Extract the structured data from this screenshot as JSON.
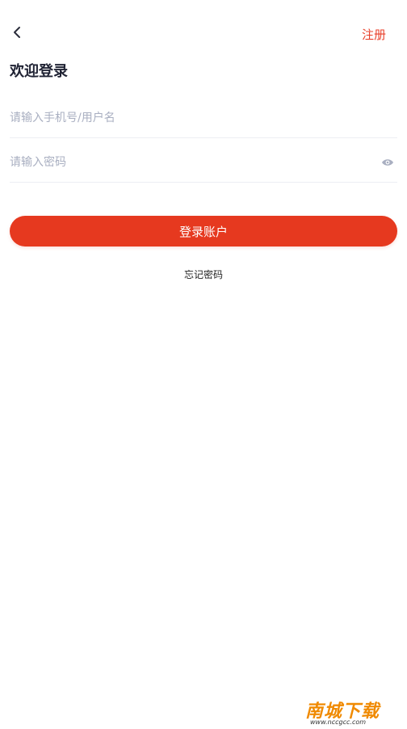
{
  "header": {
    "back_icon": "chevron-left-icon",
    "register_label": "注册"
  },
  "page": {
    "title": "欢迎登录"
  },
  "form": {
    "username_placeholder": "请输入手机号/用户名",
    "password_placeholder": "请输入密码",
    "password_toggle_icon": "eye-icon",
    "login_label": "登录账户",
    "forgot_label": "忘记密码"
  },
  "watermark": {
    "text": "南城下载",
    "sub": "www.nccgcc.com"
  },
  "colors": {
    "accent": "#e6391f",
    "title": "#1f2233",
    "placeholder": "#a9afc1",
    "divider": "#eceef3"
  }
}
